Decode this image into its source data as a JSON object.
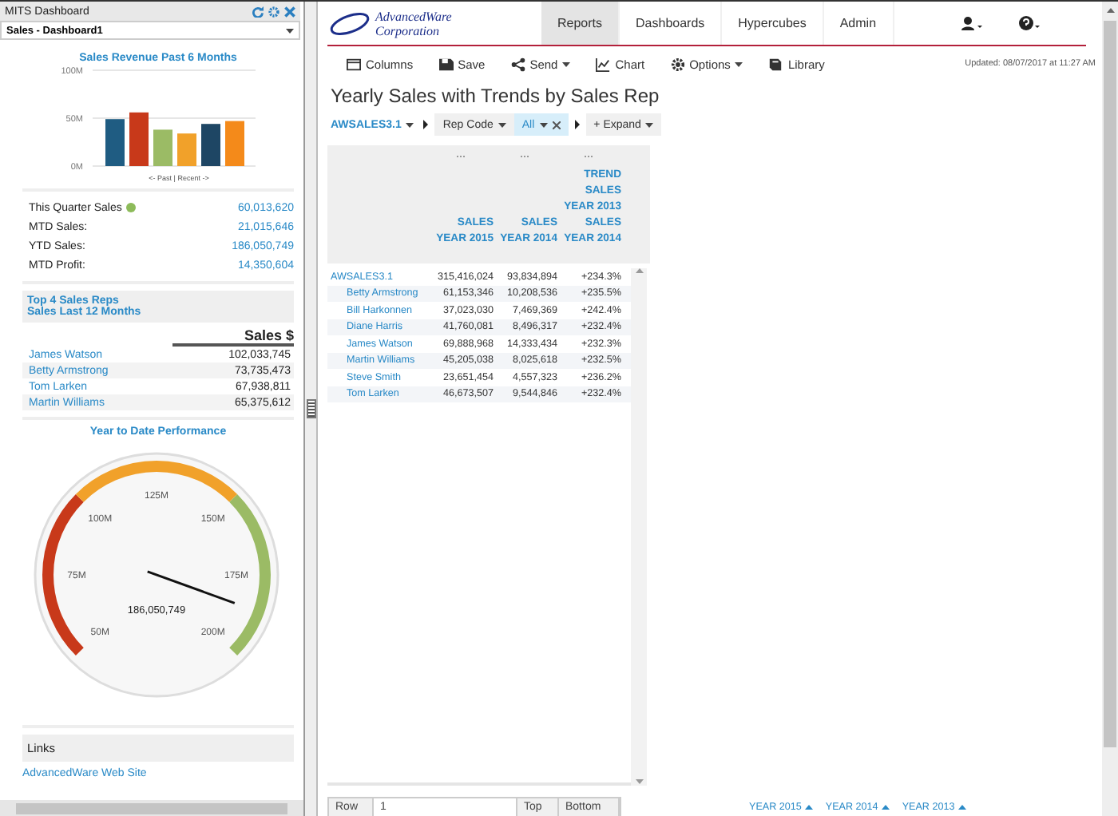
{
  "left_panel": {
    "title": "MITS Dashboard",
    "dashboard_select": "Sales - Dashboard1",
    "revenue_chart": {
      "title": "Sales Revenue Past 6 Months",
      "chart_data": {
        "type": "bar",
        "xlabel": "<- Past | Recent ->",
        "ylim": [
          0,
          100
        ],
        "yticks": [
          {
            "value": 0,
            "label": "0M"
          },
          {
            "value": 50,
            "label": "50M"
          },
          {
            "value": 100,
            "label": "100M"
          }
        ],
        "values": [
          49,
          56,
          38,
          34,
          44,
          47
        ]
      }
    },
    "stats": [
      {
        "label": "This Quarter Sales",
        "value": "60,013,620",
        "color": "#8dbb5a"
      },
      {
        "label": "MTD Sales:",
        "value": "21,015,646"
      },
      {
        "label": "YTD Sales:",
        "value": "186,050,749"
      },
      {
        "label": "MTD Profit:",
        "value": "14,350,604"
      }
    ],
    "top_reps": {
      "title": "Top 4 Sales Reps",
      "subtitle": "Sales Last 12 Months",
      "column": "Sales $",
      "rows": [
        {
          "name": "James Watson",
          "value": "102,033,745"
        },
        {
          "name": "Betty Armstrong",
          "value": "73,735,473"
        },
        {
          "name": "Tom Larken",
          "value": "67,938,811"
        },
        {
          "name": "Martin Williams",
          "value": "65,375,612"
        }
      ]
    },
    "gauge": {
      "title": "Year to Date Performance",
      "ticks": [
        "50M",
        "75M",
        "100M",
        "125M",
        "150M",
        "175M",
        "200M"
      ],
      "value_label": "186,050,749"
    },
    "links": {
      "title": "Links",
      "items": [
        "AdvancedWare Web Site"
      ]
    }
  },
  "nav": {
    "logo_line1": "AdvancedWare",
    "logo_line2": "Corporation",
    "tabs": [
      {
        "label": "Reports",
        "selected": true
      },
      {
        "label": "Dashboards",
        "selected": false
      },
      {
        "label": "Hypercubes",
        "selected": false
      },
      {
        "label": "Admin",
        "selected": false
      }
    ]
  },
  "toolbar": [
    {
      "label": "Columns",
      "kind": "columns",
      "dropdown": false
    },
    {
      "label": "Save",
      "kind": "save",
      "dropdown": false
    },
    {
      "label": "Send",
      "kind": "send",
      "dropdown": true
    },
    {
      "label": "Chart",
      "kind": "chart",
      "dropdown": false
    },
    {
      "label": "Options",
      "kind": "options",
      "dropdown": true
    },
    {
      "label": "Library",
      "kind": "library",
      "dropdown": false
    }
  ],
  "updated": "Updated: 08/07/2017 at 11:27 AM",
  "report_title": "Yearly Sales with Trends by Sales Rep",
  "filters": {
    "cube": "AWSALES3.1",
    "rep_code": "Rep Code",
    "value": "All",
    "expand": "+ Expand"
  },
  "table": {
    "columns": [
      {
        "lines": [
          "SALES",
          "YEAR 2015"
        ]
      },
      {
        "lines": [
          "SALES",
          "YEAR 2014"
        ]
      },
      {
        "lines": [
          "TREND",
          "SALES",
          "YEAR 2013",
          "SALES",
          "YEAR 2014"
        ]
      }
    ],
    "total": {
      "name": "AWSALES3.1",
      "values": [
        "315,416,024",
        "93,834,894",
        "+234.3%"
      ]
    },
    "rows": [
      {
        "name": "Betty Armstrong",
        "values": [
          "61,153,346",
          "10,208,536",
          "+235.5%"
        ]
      },
      {
        "name": "Bill Harkonnen",
        "values": [
          "37,023,030",
          "7,469,369",
          "+242.4%"
        ]
      },
      {
        "name": "Diane Harris",
        "values": [
          "41,760,081",
          "8,496,317",
          "+232.4%"
        ]
      },
      {
        "name": "James Watson",
        "values": [
          "69,888,968",
          "14,333,434",
          "+232.3%"
        ]
      },
      {
        "name": "Martin Williams",
        "values": [
          "45,205,038",
          "8,025,618",
          "+232.5%"
        ]
      },
      {
        "name": "Steve Smith",
        "values": [
          "23,651,454",
          "4,557,323",
          "+236.2%"
        ]
      },
      {
        "name": "Tom Larken",
        "values": [
          "46,673,507",
          "9,544,846",
          "+232.4%"
        ]
      }
    ]
  },
  "pager": [
    "Row",
    "1",
    "Top",
    "Bottom"
  ],
  "sorts": [
    "YEAR 2015",
    "YEAR 2014",
    "YEAR 2013"
  ]
}
